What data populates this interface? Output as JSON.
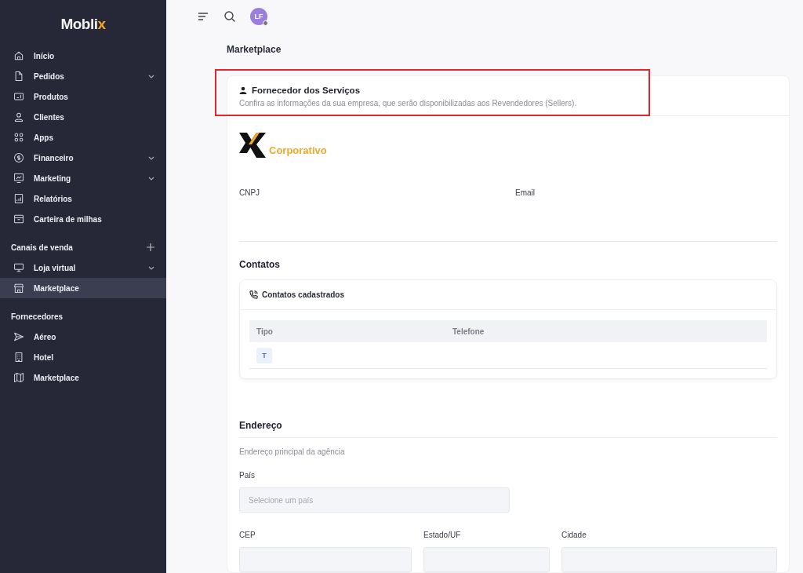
{
  "sidebar": {
    "logo": {
      "main": "Mobli",
      "accent": "x"
    },
    "items": [
      {
        "kind": "home",
        "label": "Início",
        "expandable": false,
        "selected": false
      },
      {
        "kind": "file",
        "label": "Pedidos",
        "expandable": true,
        "selected": false
      },
      {
        "kind": "ticket",
        "label": "Produtos",
        "expandable": false,
        "selected": false
      },
      {
        "kind": "user",
        "label": "Clientes",
        "expandable": false,
        "selected": false
      },
      {
        "kind": "grid",
        "label": "Apps",
        "expandable": false,
        "selected": false
      },
      {
        "kind": "dollar",
        "label": "Financeiro",
        "expandable": true,
        "selected": false
      },
      {
        "kind": "chart",
        "label": "Marketing",
        "expandable": true,
        "selected": false
      },
      {
        "kind": "report",
        "label": "Relatórios",
        "expandable": false,
        "selected": false
      },
      {
        "kind": "wallet",
        "label": "Carteira de milhas",
        "expandable": false,
        "selected": false
      }
    ],
    "sections": [
      {
        "title": "Canais de venda",
        "addable": true,
        "items": [
          {
            "kind": "monitor",
            "label": "Loja virtual",
            "expandable": true,
            "selected": false
          },
          {
            "kind": "store",
            "label": "Marketplace",
            "expandable": false,
            "selected": true
          }
        ]
      },
      {
        "title": "Fornecedores",
        "addable": false,
        "items": [
          {
            "kind": "send",
            "label": "Aéreo",
            "expandable": false,
            "selected": false
          },
          {
            "kind": "building",
            "label": "Hotel",
            "expandable": false,
            "selected": false
          },
          {
            "kind": "map",
            "label": "Marketplace",
            "expandable": false,
            "selected": false
          }
        ]
      }
    ]
  },
  "topbar": {
    "avatar": "LF"
  },
  "page_title": "Marketplace",
  "card": {
    "title": "Fornecedor dos Serviços",
    "subtitle": "Confira as informações da sua empresa, que serão disponibilizadas aos Revendedores (Sellers).",
    "highlighted": true,
    "company_logo": "Corporativo",
    "fields": [
      {
        "label": "CNPJ"
      },
      {
        "label": "Email"
      }
    ],
    "contacts": {
      "title": "Contatos",
      "panel_title": "Contatos cadastrados",
      "columns": [
        "Tipo",
        "Telefone"
      ],
      "rows": [
        {
          "badge": "T"
        }
      ]
    },
    "address": {
      "title": "Endereço",
      "subtitle": "Endereço principal da agência",
      "country_label": "País",
      "country_placeholder": "Selecione um país",
      "fields": [
        {
          "label": "CEP"
        },
        {
          "label": "Estado/UF"
        },
        {
          "label": "Cidade"
        }
      ]
    }
  }
}
